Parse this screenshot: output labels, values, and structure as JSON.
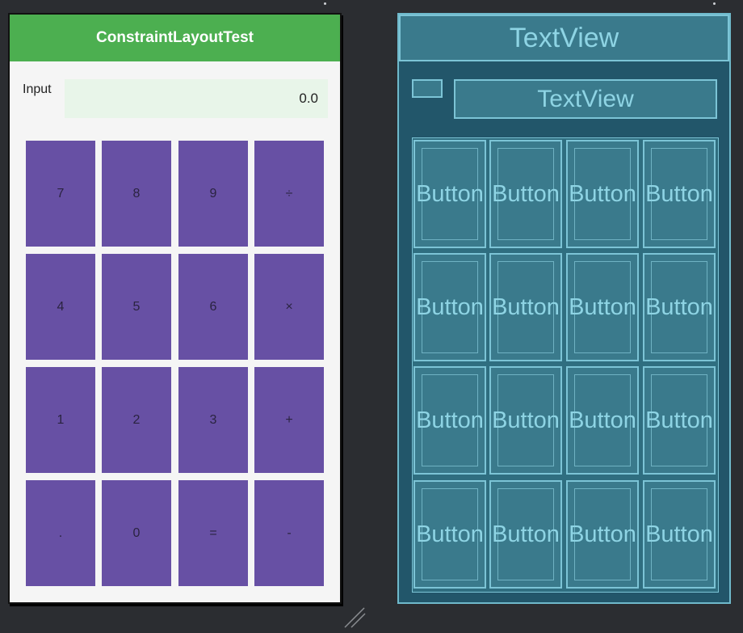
{
  "design": {
    "app_title": "ConstraintLayoutTest",
    "input_label": "Input",
    "input_value": "0.0",
    "buttons": [
      "7",
      "8",
      "9",
      "÷",
      "4",
      "5",
      "6",
      "×",
      "1",
      "2",
      "3",
      "+",
      ".",
      "0",
      "=",
      "-"
    ],
    "colors": {
      "appbar": "#4caf50",
      "button": "#6750a4",
      "input_bg": "#e8f5e9"
    }
  },
  "blueprint": {
    "title_text": "TextView",
    "input_text": "TextView",
    "button_text": "Button",
    "colors": {
      "background": "#22566a",
      "outline": "#7cc4d6",
      "text": "#8ed4e4"
    }
  }
}
